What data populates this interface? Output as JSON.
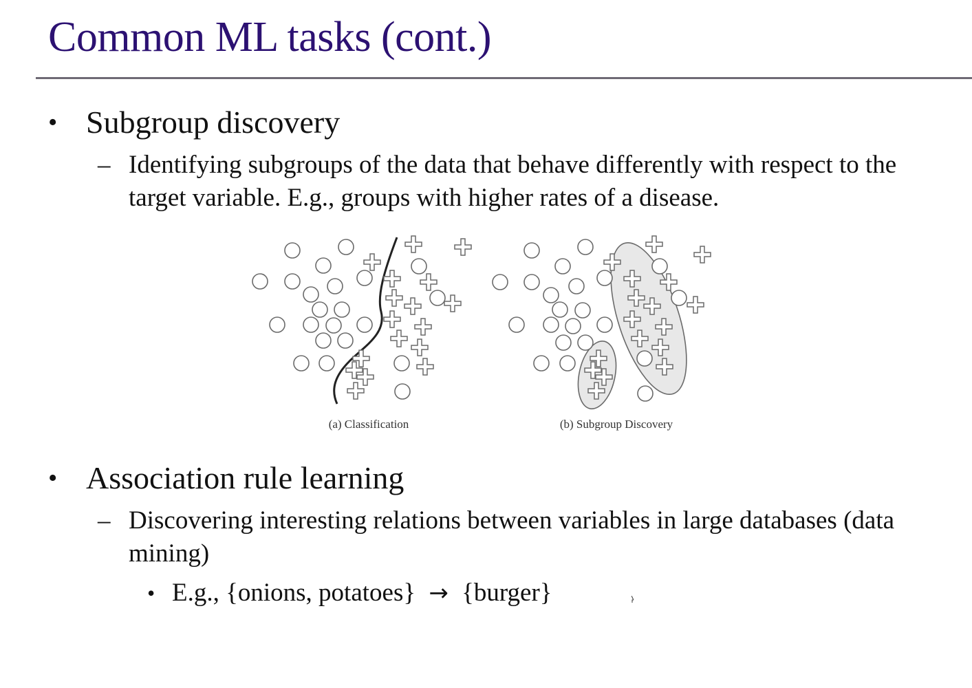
{
  "slide": {
    "title": "Common ML tasks (cont.)",
    "bullets": [
      {
        "label": "Subgroup discovery",
        "sub": "Identifying subgroups of the data that behave differently with respect to the target variable. E.g., groups with higher rates of a disease."
      },
      {
        "label": "Association rule learning",
        "sub": "Discovering interesting relations between variables in large databases (data mining)",
        "example_prefix": "E.g., {onions, potatoes}",
        "example_arrow": "→",
        "example_suffix": "{burger}"
      }
    ],
    "bullet_symbol": "•",
    "dash_symbol": "–"
  },
  "figure": {
    "captions": {
      "a": "(a) Classification",
      "b": "(b) Subgroup Discovery"
    },
    "colors": {
      "title": "#2c1172",
      "stroke": "#6a6a6a",
      "boundary": "#222222",
      "ellipse_fill": "#e8e8e8"
    }
  }
}
